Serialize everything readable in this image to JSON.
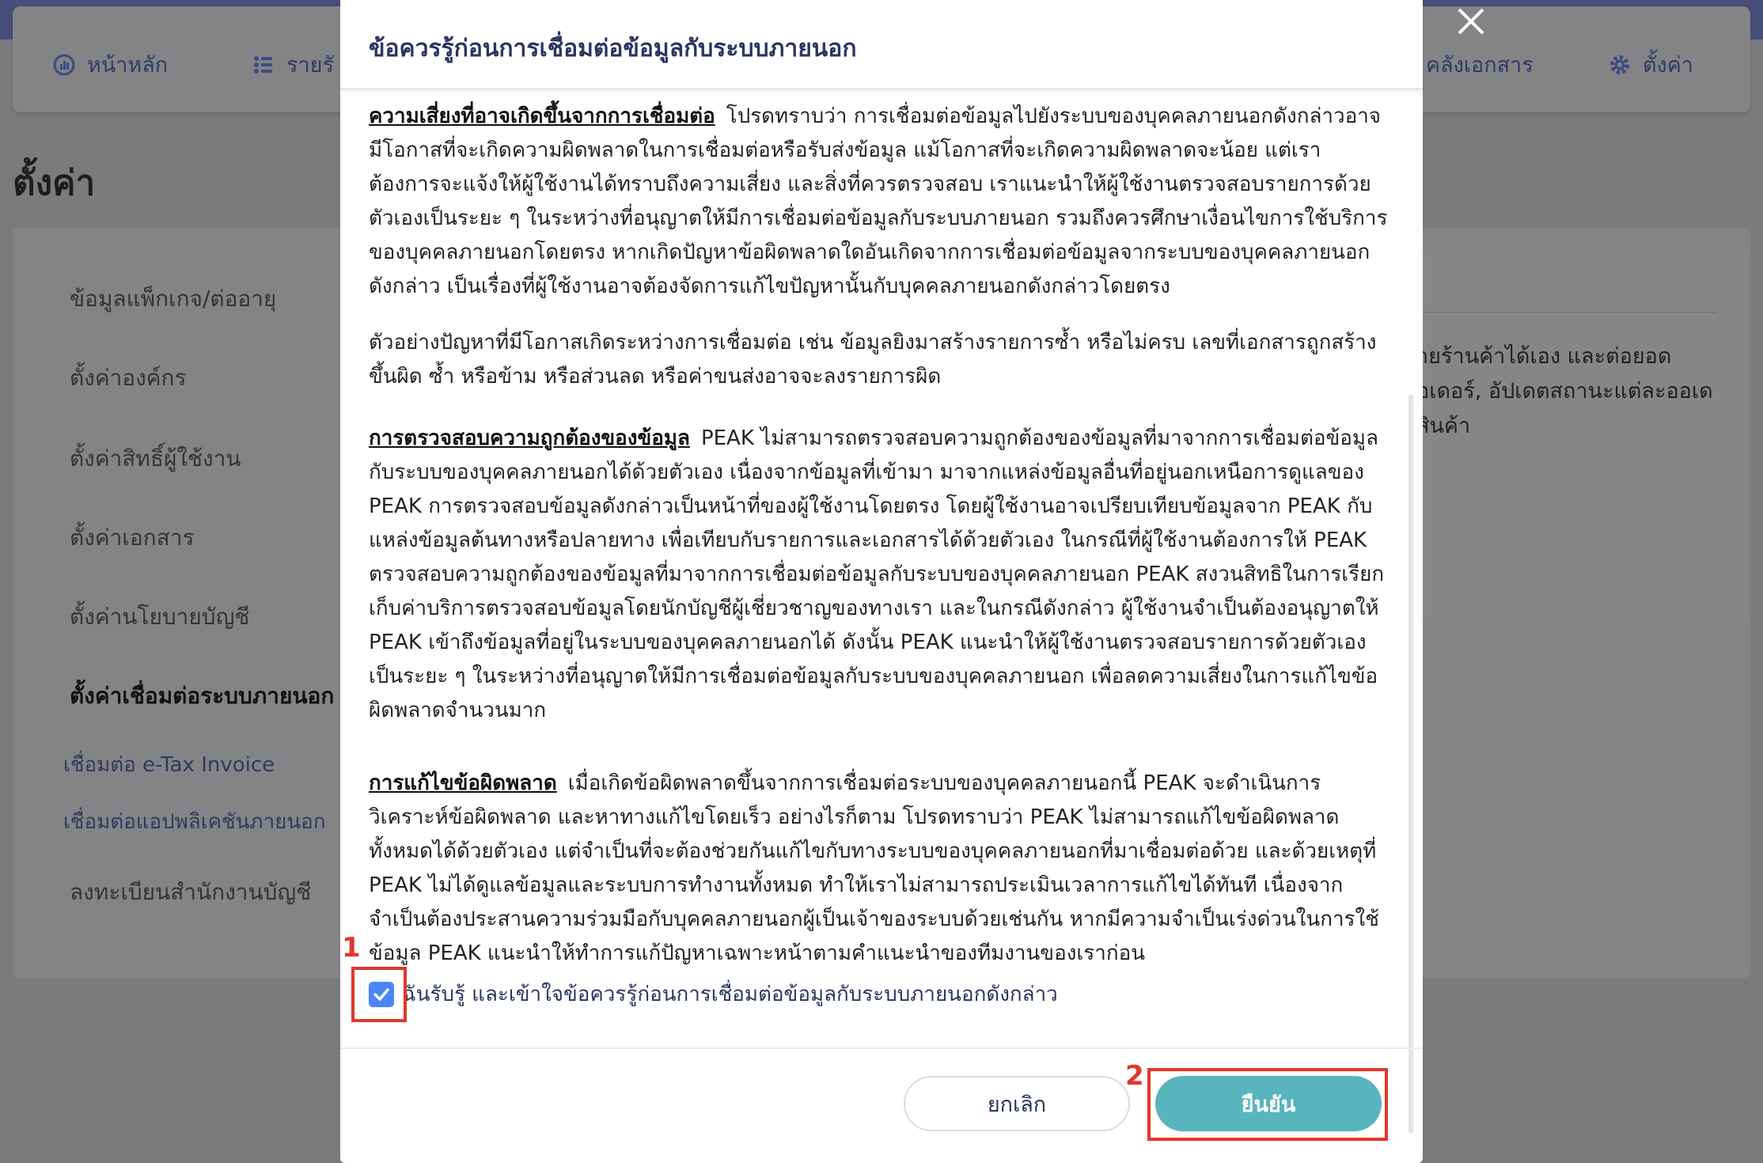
{
  "nav": {
    "home": "หน้าหลัก",
    "income": "รายรั",
    "documents": "คลังเอกสาร",
    "settings": "ตั้งค่า"
  },
  "page": {
    "title": "ตั้งค่า"
  },
  "sidebar": {
    "items": [
      {
        "label": "ข้อมูลแพ็กเกจ/ต่ออายุ"
      },
      {
        "label": "ตั้งค่าองค์กร"
      },
      {
        "label": "ตั้งค่าสิทธิ์ผู้ใช้งาน"
      },
      {
        "label": "ตั้งค่าเอกสาร"
      },
      {
        "label": "ตั้งค่านโยบายบัญชี"
      },
      {
        "label": "ตั้งค่าเชื่อมต่อระบบภายนอก"
      }
    ],
    "subitems": [
      {
        "label": "เชื่อมต่อ e-Tax Invoice"
      },
      {
        "label": "เชื่อมต่อแอปพลิเคชันภายนอก"
      }
    ],
    "register": "ลงทะเบียนสำนักงานบัญชี"
  },
  "content": {
    "lines": [
      "ายร้านค้าได้เอง และต่อยอด",
      "อเดอร์, อัปเดตสถานะแต่ละออเด",
      "สินค้า"
    ]
  },
  "modal": {
    "title": "ข้อควรรู้ก่อนการเชื่อมต่อข้อมูลกับระบบภายนอก",
    "sections": [
      {
        "title": "ความเสี่ยงที่อาจเกิดขึ้นจากการเชื่อมต่อ",
        "body": "โปรดทราบว่า การเชื่อมต่อข้อมูลไปยังระบบของบุคคลภายนอกดังกล่าวอาจมีโอกาสที่จะเกิดความผิดพลาดในการเชื่อมต่อหรือรับส่งข้อมูล แม้โอกาสที่จะเกิดความผิดพลาดจะน้อย แต่เราต้องการจะแจ้งให้ผู้ใช้งานได้ทราบถึงความเสี่ยง และสิ่งที่ควรตรวจสอบ เราแนะนำให้ผู้ใช้งานตรวจสอบรายการด้วยตัวเองเป็นระยะ ๆ ในระหว่างที่อนุญาตให้มีการเชื่อมต่อข้อมูลกับระบบภายนอก รวมถึงควรศึกษาเงื่อนไขการใช้บริการของบุคคลภายนอกโดยตรง หากเกิดปัญหาข้อผิดพลาดใดอันเกิดจากการเชื่อมต่อข้อมูลจากระบบของบุคคลภายนอกดังกล่าว เป็นเรื่องที่ผู้ใช้งานอาจต้องจัดการแก้ไขปัญหานั้นกับบุคคลภายนอกดังกล่าวโดยตรง"
      },
      {
        "title": "",
        "body": "ตัวอย่างปัญหาที่มีโอกาสเกิดระหว่างการเชื่อมต่อ เช่น ข้อมูลยิงมาสร้างรายการซ้ำ หรือไม่ครบ เลขที่เอกสารถูกสร้างขึ้นผิด ซ้ำ หรือข้าม หรือส่วนลด หรือค่าขนส่งอาจจะลงรายการผิด"
      },
      {
        "title": "การตรวจสอบความถูกต้องของข้อมูล",
        "body": "PEAK ไม่สามารถตรวจสอบความถูกต้องของข้อมูลที่มาจากการเชื่อมต่อข้อมูลกับระบบของบุคคลภายนอกได้ด้วยตัวเอง เนื่องจากข้อมูลที่เข้ามา มาจากแหล่งข้อมูลอื่นที่อยู่นอกเหนือการดูแลของ PEAK การตรวจสอบข้อมูลดังกล่าวเป็นหน้าที่ของผู้ใช้งานโดยตรง โดยผู้ใช้งานอาจเปรียบเทียบข้อมูลจาก PEAK กับแหล่งข้อมูลต้นทางหรือปลายทาง เพื่อเทียบกับรายการและเอกสารได้ด้วยตัวเอง ในกรณีที่ผู้ใช้งานต้องการให้ PEAK ตรวจสอบความถูกต้องของข้อมูลที่มาจากการเชื่อมต่อข้อมูลกับระบบของบุคคลภายนอก PEAK สงวนสิทธิในการเรียกเก็บค่าบริการตรวจสอบข้อมูลโดยนักบัญชีผู้เชี่ยวชาญของทางเรา และในกรณีดังกล่าว ผู้ใช้งานจำเป็นต้องอนุญาตให้ PEAK เข้าถึงข้อมูลที่อยู่ในระบบของบุคคลภายนอกได้ ดังนั้น PEAK แนะนำให้ผู้ใช้งานตรวจสอบรายการด้วยตัวเองเป็นระยะ ๆ ในระหว่างที่อนุญาตให้มีการเชื่อมต่อข้อมูลกับระบบของบุคคลภายนอก เพื่อลดความเสี่ยงในการแก้ไขข้อผิดพลาดจำนวนมาก"
      },
      {
        "title": "การแก้ไขข้อผิดพลาด",
        "body": "เมื่อเกิดข้อผิดพลาดขึ้นจากการเชื่อมต่อระบบของบุคคลภายนอกนี้ PEAK จะดำเนินการวิเคราะห์ข้อผิดพลาด และหาทางแก้ไขโดยเร็ว อย่างไรก็ตาม โปรดทราบว่า PEAK ไม่สามารถแก้ไขข้อผิดพลาดทั้งหมดได้ด้วยตัวเอง แต่จำเป็นที่จะต้องช่วยกันแก้ไขกับทางระบบของบุคคลภายนอกที่มาเชื่อมต่อด้วย และด้วยเหตุที่ PEAK ไม่ได้ดูแลข้อมูลและระบบการทำงานทั้งหมด ทำให้เราไม่สามารถประเมินเวลาการแก้ไขได้ทันที เนื่องจากจำเป็นต้องประสานความร่วมมือกับบุคคลภายนอกผู้เป็นเจ้าของระบบด้วยเช่นกัน หากมีความจำเป็นเร่งด่วนในการใช้ข้อมูล PEAK แนะนำให้ทำการแก้ปัญหาเฉพาะหน้าตามคำแนะนำของทีมงานของเราก่อน"
      }
    ],
    "acknowledge": "ฉันรับรู้ และเข้าใจข้อควรรู้ก่อนการเชื่อมต่อข้อมูลกับระบบภายนอกดังกล่าว",
    "acknowledge_checked": true,
    "cancel": "ยกเลิก",
    "confirm": "ยืนยัน"
  },
  "annotations": {
    "step1": "1",
    "step2": "2"
  },
  "colors": {
    "accent": "#58b4bd",
    "checkbox": "#4a86f7",
    "annotation": "#e0372c",
    "title": "#2a3560"
  }
}
